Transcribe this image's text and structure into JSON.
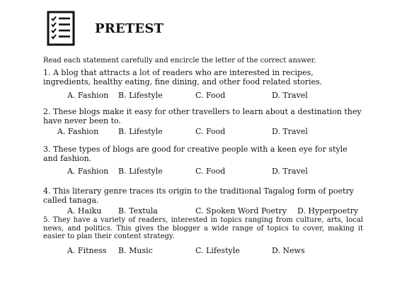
{
  "header": {
    "title": "PRETEST",
    "icon": "checklist-icon"
  },
  "instructions": "Read each statement carefully and encircle the letter of the correct answer.",
  "questions": [
    {
      "text": "1. A blog that attracts a lot of readers who are interested in recipes, ingredients, healthy eating, fine dining, and other food related stories.",
      "options": [
        "A. Fashion",
        "B. Lifestyle",
        "C. Food",
        "D. Travel"
      ]
    },
    {
      "text": "2. These blogs make it easy for other travellers to learn about a destination they have never been to.",
      "options": [
        "A. Fashion",
        "B. Lifestyle",
        "C. Food",
        "D. Travel"
      ]
    },
    {
      "text": "3. These types of blogs are good for creative people with a keen eye for style and fashion.",
      "options": [
        "A. Fashion",
        "B. Lifestyle",
        "C. Food",
        "D. Travel"
      ]
    },
    {
      "text": "4. This literary genre traces its origin to the traditional Tagalog form of poetry called tanaga.",
      "options": [
        "A. Haiku",
        "B. Textula",
        "C. Spoken Word Poetry",
        "D. Hyperpoetry"
      ]
    },
    {
      "text": "5. They have a variety of readers, interested in topics ranging from culture, arts, local news, and politics. This gives the blogger a wide range of topics to cover, making it easier to plan their content strategy.",
      "options": [
        "A. Fitness",
        "B. Music",
        "C. Lifestyle",
        "D. News"
      ]
    }
  ]
}
